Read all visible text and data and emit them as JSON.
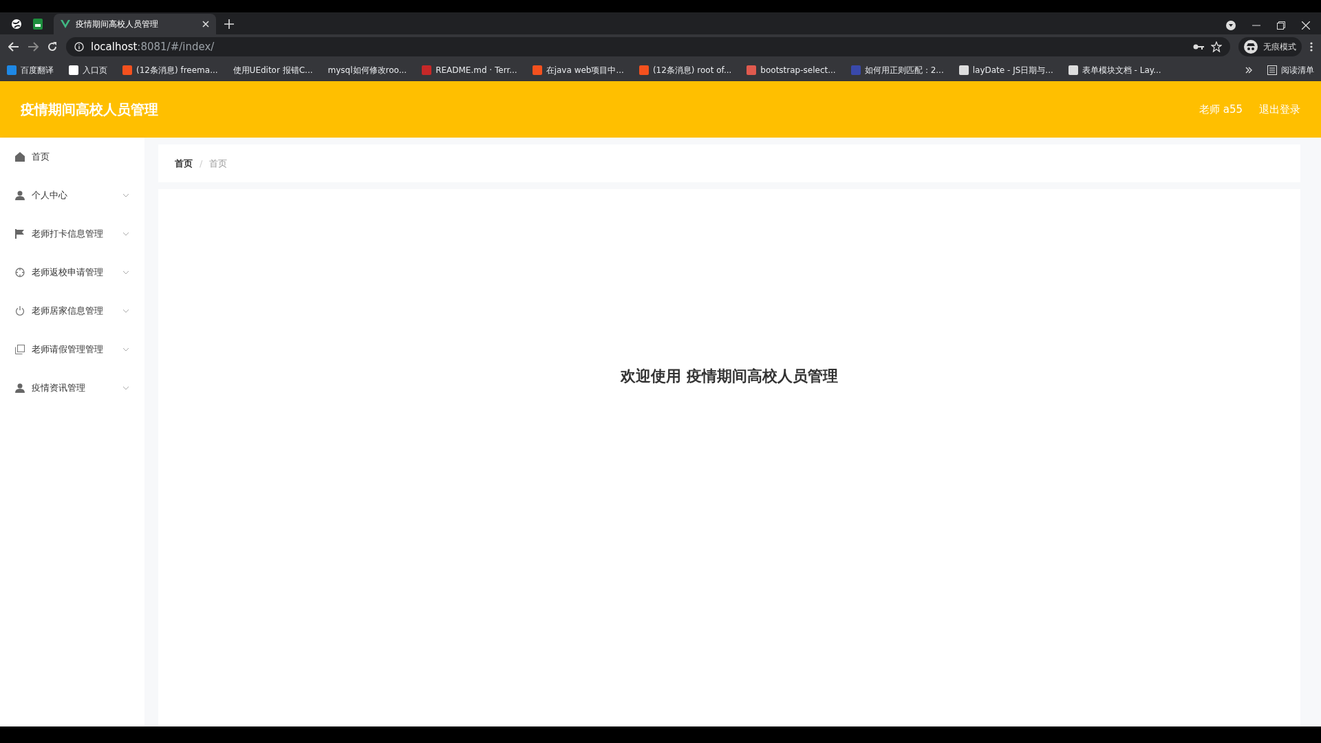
{
  "browser": {
    "tabs": [
      {
        "title": "疫情期间高校人员管理",
        "selected": true
      }
    ],
    "url": {
      "host": "localhost",
      "path": ":8081/#/index/"
    },
    "profile": "无痕模式",
    "bookmarks": [
      {
        "label": "百度翻译",
        "color": "#1e88e5"
      },
      {
        "label": "入口页",
        "color": "#ffffff"
      },
      {
        "label": "(12条消息) freema...",
        "color": "#f4511e"
      },
      {
        "label": "使用UEditor 报错C..."
      },
      {
        "label": "mysql如何修改roo..."
      },
      {
        "label": "README.md · Terr...",
        "color": "#c62828"
      },
      {
        "label": "在java web项目中...",
        "color": "#f4511e"
      },
      {
        "label": "(12条消息) root of...",
        "color": "#f4511e"
      },
      {
        "label": "bootstrap-select...",
        "color": "#e05a4e"
      },
      {
        "label": "如何用正则匹配：2...",
        "color": "#3949ab"
      },
      {
        "label": "layDate - JS日期与...",
        "color": "#dddddd"
      },
      {
        "label": "表单模块文档 - Lay...",
        "color": "#dddddd"
      }
    ],
    "reading_list": "阅读清单"
  },
  "app": {
    "title": "疫情期间高校人员管理",
    "user": "老师 a55",
    "logout": "退出登录"
  },
  "sidebar": {
    "items": [
      {
        "label": "首页",
        "kind": "home",
        "expandable": false
      },
      {
        "label": "个人中心",
        "kind": "user",
        "expandable": true
      },
      {
        "label": "老师打卡信息管理",
        "kind": "flag",
        "expandable": true
      },
      {
        "label": "老师返校申请管理",
        "kind": "target",
        "expandable": true
      },
      {
        "label": "老师居家信息管理",
        "kind": "power",
        "expandable": true
      },
      {
        "label": "老师请假管理管理",
        "kind": "copy",
        "expandable": true
      },
      {
        "label": "疫情资讯管理",
        "kind": "user",
        "expandable": true
      }
    ]
  },
  "breadcrumb": {
    "separator": "/",
    "items": [
      "首页",
      "首页"
    ]
  },
  "welcome": "欢迎使用 疫情期间高校人员管理"
}
